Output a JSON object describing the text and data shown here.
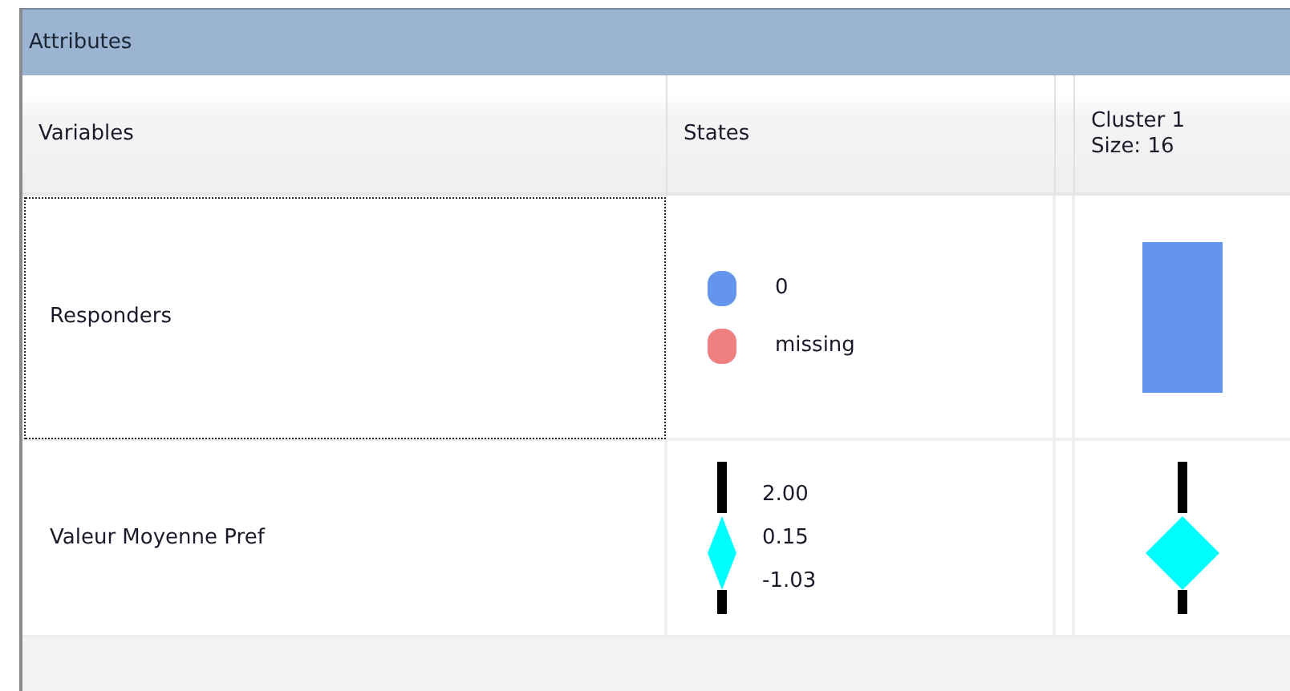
{
  "panel": {
    "title": "Attributes"
  },
  "columns": [
    {
      "label": "Variables"
    },
    {
      "label": "States"
    },
    {
      "label": "Cluster 1",
      "sublabel": "Size: 16"
    }
  ],
  "rows": [
    {
      "kind": "categorical",
      "variable": "Responders",
      "selected": true,
      "states": [
        {
          "label": "0",
          "color": "#6495ed"
        },
        {
          "label": "missing",
          "color": "#f08080"
        }
      ]
    },
    {
      "kind": "continuous",
      "variable": "Valeur Moyenne Pref",
      "selected": false,
      "states": [
        {
          "label": "2.00"
        },
        {
          "label": "0.15"
        },
        {
          "label": "-1.03"
        }
      ]
    }
  ]
}
